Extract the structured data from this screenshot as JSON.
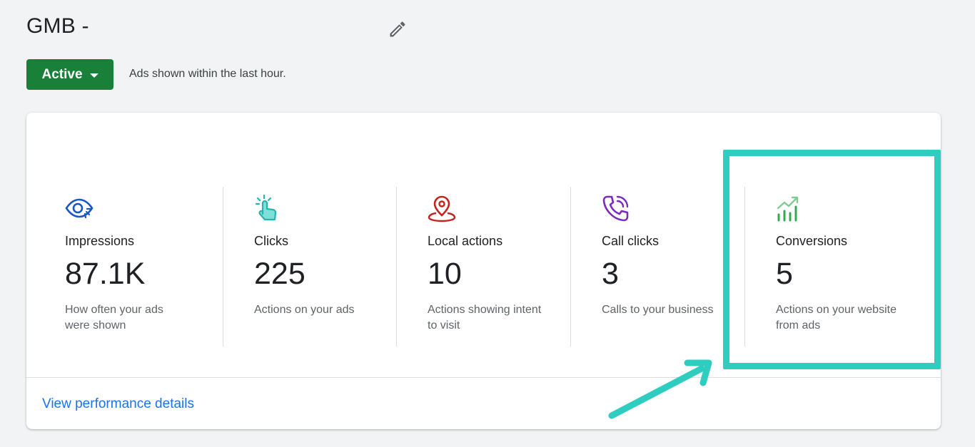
{
  "header": {
    "title": "GMB -",
    "edit_icon": "pencil-icon"
  },
  "status": {
    "label": "Active",
    "message": "Ads shown within the last hour.",
    "color": "#188038"
  },
  "metrics": [
    {
      "icon": "eye-icon",
      "icon_color": "#1a56c4",
      "label": "Impressions",
      "value": "87.1K",
      "desc": "How often your ads were shown"
    },
    {
      "icon": "tap-icon",
      "icon_color": "#24b5b0",
      "label": "Clicks",
      "value": "225",
      "desc": "Actions on your ads"
    },
    {
      "icon": "location-pin-icon",
      "icon_color": "#c5221f",
      "label": "Local actions",
      "value": "10",
      "desc": "Actions showing intent to visit"
    },
    {
      "icon": "phone-call-icon",
      "icon_color": "#7b2cbf",
      "label": "Call clicks",
      "value": "3",
      "desc": "Calls to your business"
    },
    {
      "icon": "trending-chart-icon",
      "icon_color": "#34a853",
      "label": "Conversions",
      "value": "5",
      "desc": "Actions on your website from ads"
    }
  ],
  "footer": {
    "link_label": "View performance details",
    "link_color": "#1a73e8"
  },
  "annotation": {
    "highlight_color": "#2ecdc0"
  }
}
